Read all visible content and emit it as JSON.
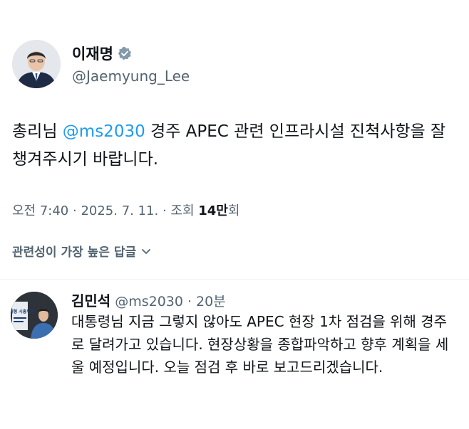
{
  "tweet": {
    "author_name": "이재명",
    "author_handle": "@Jaemyung_Lee",
    "text_before_mention": "총리님 ",
    "mention": "@ms2030",
    "text_after_mention": " 경주 APEC 관련 인프라시설 진척사항을 잘 챙겨주시기 바랍니다.",
    "time": "오전 7:40",
    "separator": " · ",
    "date": "2025. 7. 11.",
    "views_label_before": "조회 ",
    "views_count": "14만",
    "views_label_after": "회",
    "verified_icon": "verified-badge-icon",
    "mention_color": "#1d9bf0"
  },
  "replies_sort": {
    "label": "관련성이 가장 높은 답글"
  },
  "reply": {
    "author_name": "김민석",
    "author_handle": "@ms2030",
    "separator": "·",
    "time_ago": "20분",
    "text": "대통령님 지금 그렇지 않아도 APEC 현장 1차 점검을 위해 경주로 달려가고 있습니다. 현장상황을 종합파악하고 향후 계획을 세울 예정입니다. 오늘 점검 후 바로 보고드리겠습니다.",
    "avatar_text": "김대형 시흥위원"
  }
}
